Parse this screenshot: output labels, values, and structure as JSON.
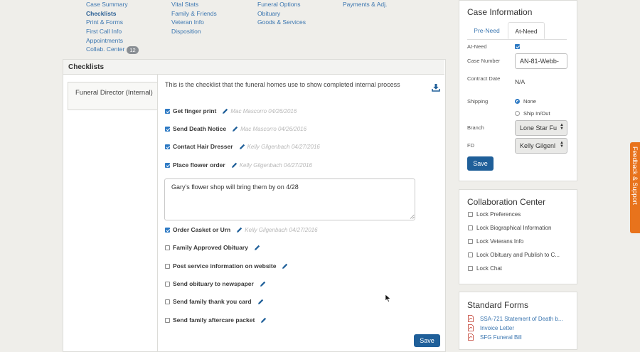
{
  "nav": {
    "col1": [
      "Case Summary",
      "Checklists",
      "Print & Forms",
      "First Call Info",
      "Appointments",
      "Collab. Center"
    ],
    "collab_count": "12",
    "col2": [
      "Vital Stats",
      "Family & Friends",
      "Veteran Info",
      "Disposition"
    ],
    "col3": [
      "Funeral Options",
      "Obituary",
      "Goods & Services"
    ],
    "col4": [
      "Payments & Adj."
    ]
  },
  "checklists": {
    "title": "Checklists",
    "tab_label": "Funeral Director (Internal)",
    "description": "This is the checklist that the funeral homes use to show completed internal process",
    "items": [
      {
        "label": "Get finger print",
        "checked": true,
        "meta": "Mac Mascorro 04/26/2016"
      },
      {
        "label": "Send Death Notice",
        "checked": true,
        "meta": "Mac Mascorro 04/26/2016"
      },
      {
        "label": "Contact Hair Dresser",
        "checked": true,
        "meta": "Kelly Gilgenbach 04/27/2016"
      },
      {
        "label": "Place flower order",
        "checked": true,
        "meta": "Kelly Gilgenbach 04/27/2016"
      },
      {
        "label": "Order Casket or Urn",
        "checked": true,
        "meta": "Kelly Gilgenbach 04/27/2016"
      },
      {
        "label": "Family Approved Obituary",
        "checked": false,
        "meta": ""
      },
      {
        "label": "Post service information on website",
        "checked": false,
        "meta": ""
      },
      {
        "label": "Send obituary to newspaper",
        "checked": false,
        "meta": ""
      },
      {
        "label": "Send family thank you card",
        "checked": false,
        "meta": ""
      },
      {
        "label": "Send family aftercare packet",
        "checked": false,
        "meta": ""
      }
    ],
    "note": "Gary's flower shop will bring them by on 4/28",
    "save_label": "Save"
  },
  "case_info": {
    "title": "Case Information",
    "tab_preneed": "Pre-Need",
    "tab_atneed": "At-Need",
    "at_need_label": "At-Need",
    "case_number_label": "Case Number",
    "case_number": "AN-81-Webb-",
    "contract_date_label": "Contract Date",
    "contract_date": "N/A",
    "shipping_label": "Shipping",
    "shipping_none": "None",
    "shipping_inout": "Ship In/Out",
    "branch_label": "Branch",
    "branch_value": "Lone Star Fu",
    "fd_label": "FD",
    "fd_value": "Kelly Gilgenl",
    "save_label": "Save"
  },
  "collab": {
    "title": "Collaboration Center",
    "items": [
      "Lock Preferences",
      "Lock Biographical Information",
      "Lock Veterans Info",
      "Lock Obituary and Publish to C...",
      "Lock Chat"
    ]
  },
  "forms": {
    "title": "Standard Forms",
    "items": [
      "SSA-721 Statement of Death b...",
      "Invoice Letter",
      "SFG Funeral Bill"
    ]
  },
  "feedback_label": "Feedback & Support",
  "colors": {
    "accent": "#1f5f99",
    "link": "#3b76b0",
    "check": "#2e7ac4",
    "feedback": "#e8731c"
  }
}
